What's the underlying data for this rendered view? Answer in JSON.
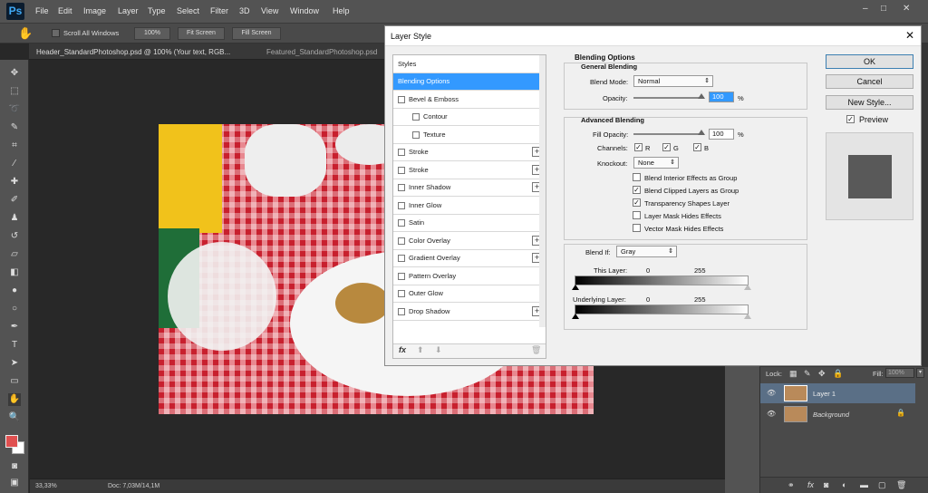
{
  "app": {
    "logo": "Ps"
  },
  "menu": [
    "File",
    "Edit",
    "Image",
    "Layer",
    "Type",
    "Select",
    "Filter",
    "3D",
    "View",
    "Window",
    "Help"
  ],
  "window_controls": [
    "–",
    "□",
    "✕"
  ],
  "options_bar": {
    "scroll_all_label": "Scroll All Windows",
    "zoom_button": "100%",
    "fit_screen": "Fit Screen",
    "fill_screen": "Fill Screen"
  },
  "doc_tabs": [
    "Header_StandardPhotoshop.psd @ 100% (Your text, RGB...",
    "Featured_StandardPhotoshop.psd"
  ],
  "status": {
    "zoom": "33,33%",
    "doc": "Doc: 7,03M/14,1M"
  },
  "layers_panel": {
    "lock_label": "Lock:",
    "fill_label": "Fill:",
    "fill_value": "100%",
    "layers": [
      {
        "name": "Layer 1",
        "selected": true
      },
      {
        "name": "Background",
        "selected": false
      }
    ]
  },
  "dialog": {
    "title": "Layer Style",
    "styles_header": "Styles",
    "styles": [
      {
        "label": "Blending Options",
        "selected": true,
        "checkbox": false,
        "plus": false,
        "indent": false
      },
      {
        "label": "Bevel & Emboss",
        "checkbox": true,
        "plus": false,
        "indent": false
      },
      {
        "label": "Contour",
        "checkbox": true,
        "plus": false,
        "indent": true
      },
      {
        "label": "Texture",
        "checkbox": true,
        "plus": false,
        "indent": true
      },
      {
        "label": "Stroke",
        "checkbox": true,
        "plus": true,
        "indent": false
      },
      {
        "label": "Stroke",
        "checkbox": true,
        "plus": true,
        "indent": false
      },
      {
        "label": "Inner Shadow",
        "checkbox": true,
        "plus": true,
        "indent": false
      },
      {
        "label": "Inner Glow",
        "checkbox": true,
        "plus": false,
        "indent": false
      },
      {
        "label": "Satin",
        "checkbox": true,
        "plus": false,
        "indent": false
      },
      {
        "label": "Color Overlay",
        "checkbox": true,
        "plus": true,
        "indent": false
      },
      {
        "label": "Gradient Overlay",
        "checkbox": true,
        "plus": true,
        "indent": false
      },
      {
        "label": "Pattern Overlay",
        "checkbox": true,
        "plus": false,
        "indent": false
      },
      {
        "label": "Outer Glow",
        "checkbox": true,
        "plus": false,
        "indent": false
      },
      {
        "label": "Drop Shadow",
        "checkbox": true,
        "plus": true,
        "indent": false
      }
    ],
    "fx_label": "fx",
    "blending_options_title": "Blending Options",
    "general": {
      "title": "General Blending",
      "blend_mode_label": "Blend Mode:",
      "blend_mode_value": "Normal",
      "opacity_label": "Opacity:",
      "opacity_value": "100",
      "percent": "%"
    },
    "advanced": {
      "title": "Advanced Blending",
      "fill_opacity_label": "Fill Opacity:",
      "fill_opacity_value": "100",
      "channels_label": "Channels:",
      "channels": [
        {
          "label": "R",
          "checked": true
        },
        {
          "label": "G",
          "checked": true
        },
        {
          "label": "B",
          "checked": true
        }
      ],
      "knockout_label": "Knockout:",
      "knockout_value": "None",
      "options": [
        {
          "label": "Blend Interior Effects as Group",
          "checked": false
        },
        {
          "label": "Blend Clipped Layers as Group",
          "checked": true
        },
        {
          "label": "Transparency Shapes Layer",
          "checked": true
        },
        {
          "label": "Layer Mask Hides Effects",
          "checked": false
        },
        {
          "label": "Vector Mask Hides Effects",
          "checked": false
        }
      ]
    },
    "blend_if": {
      "label": "Blend If:",
      "value": "Gray",
      "this_layer_label": "This Layer:",
      "this_layer_min": "0",
      "this_layer_max": "255",
      "underlying_label": "Underlying Layer:",
      "underlying_min": "0",
      "underlying_max": "255"
    },
    "buttons": {
      "ok": "OK",
      "cancel": "Cancel",
      "new_style": "New Style...",
      "preview": "Preview"
    },
    "preview_checked": true
  }
}
